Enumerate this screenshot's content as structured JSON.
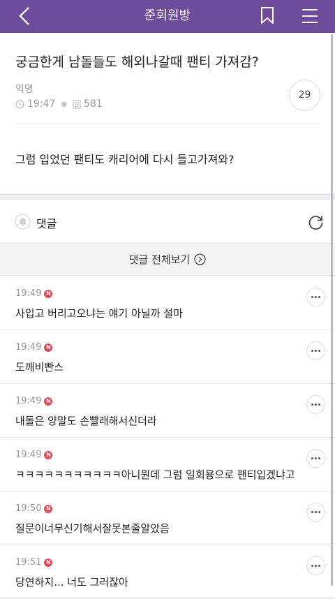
{
  "header": {
    "title": "준회원방"
  },
  "post": {
    "title": "궁금한게 남돌들도 해외나갈때 팬티 가져감?",
    "author": "익명",
    "time": "19:47",
    "views": "581",
    "comment_count": "29",
    "body": "그럼 입었던 팬티도 캐리어에 다시 들고가져와?"
  },
  "comments_section": {
    "label": "댓글",
    "view_all": "댓글 전체보기",
    "items": [
      {
        "time": "19:49",
        "badge": "N",
        "text": "사입고 버리고오냐는 얘기 아닐까 설마"
      },
      {
        "time": "19:49",
        "badge": "N",
        "text": "도깨비빤스"
      },
      {
        "time": "19:49",
        "badge": "N",
        "text": "내돌은 양말도 손빨래해서신더라"
      },
      {
        "time": "19:49",
        "badge": "N",
        "text": "ㅋㅋㅋㅋㅋㅋㅋㅋㅋㅋㅋ아니뭔데 그럼 일회용으로 팬티입겠냐고"
      },
      {
        "time": "19:50",
        "badge": "N",
        "text": "질문이너무신기해서잘못본줄알았음"
      },
      {
        "time": "19:51",
        "badge": "N",
        "text": "당연하지... 너도 그러잖아"
      }
    ]
  },
  "colors": {
    "header_bg": "#6f4b9c",
    "new_badge": "#e8475a"
  }
}
